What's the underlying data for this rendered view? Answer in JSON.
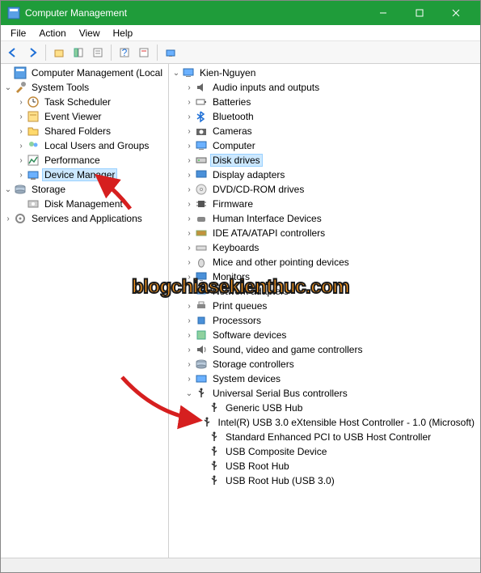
{
  "window": {
    "title": "Computer Management"
  },
  "menu": [
    "File",
    "Action",
    "View",
    "Help"
  ],
  "left": {
    "root": "Computer Management (Local",
    "systools": "System Tools",
    "items1": [
      {
        "label": "Task Scheduler",
        "icon": "clock"
      },
      {
        "label": "Event Viewer",
        "icon": "event"
      },
      {
        "label": "Shared Folders",
        "icon": "folder"
      },
      {
        "label": "Local Users and Groups",
        "icon": "users"
      },
      {
        "label": "Performance",
        "icon": "perf"
      },
      {
        "label": "Device Manager",
        "icon": "device",
        "selected": true
      }
    ],
    "storage": "Storage",
    "items2": [
      {
        "label": "Disk Management",
        "icon": "disk"
      }
    ],
    "services": "Services and Applications"
  },
  "right": {
    "root": "Kien-Nguyen",
    "items": [
      {
        "label": "Audio inputs and outputs",
        "icon": "audio"
      },
      {
        "label": "Batteries",
        "icon": "battery"
      },
      {
        "label": "Bluetooth",
        "icon": "bt"
      },
      {
        "label": "Cameras",
        "icon": "camera"
      },
      {
        "label": "Computer",
        "icon": "pc"
      },
      {
        "label": "Disk drives",
        "icon": "hdd",
        "hl": true
      },
      {
        "label": "Display adapters",
        "icon": "display"
      },
      {
        "label": "DVD/CD-ROM drives",
        "icon": "cd"
      },
      {
        "label": "Firmware",
        "icon": "chip"
      },
      {
        "label": "Human Interface Devices",
        "icon": "hid"
      },
      {
        "label": "IDE ATA/ATAPI controllers",
        "icon": "ide"
      },
      {
        "label": "Keyboards",
        "icon": "kb"
      },
      {
        "label": "Mice and other pointing devices",
        "icon": "mouse"
      },
      {
        "label": "Monitors",
        "icon": "monitor"
      },
      {
        "label": "Network adapters",
        "icon": "net"
      },
      {
        "label": "Print queues",
        "icon": "print"
      },
      {
        "label": "Processors",
        "icon": "cpu"
      },
      {
        "label": "Software devices",
        "icon": "sw"
      },
      {
        "label": "Sound, video and game controllers",
        "icon": "sound"
      },
      {
        "label": "Storage controllers",
        "icon": "storage"
      },
      {
        "label": "System devices",
        "icon": "sys"
      },
      {
        "label": "Universal Serial Bus controllers",
        "icon": "usb",
        "expanded": true,
        "children": [
          {
            "label": "Generic USB Hub"
          },
          {
            "label": "Intel(R) USB 3.0 eXtensible Host Controller - 1.0 (Microsoft)"
          },
          {
            "label": "Standard Enhanced PCI to USB Host Controller"
          },
          {
            "label": "USB Composite Device"
          },
          {
            "label": "USB Root Hub"
          },
          {
            "label": "USB Root Hub (USB 3.0)"
          }
        ]
      }
    ]
  },
  "watermark": "blogchiasekienthuc.com"
}
